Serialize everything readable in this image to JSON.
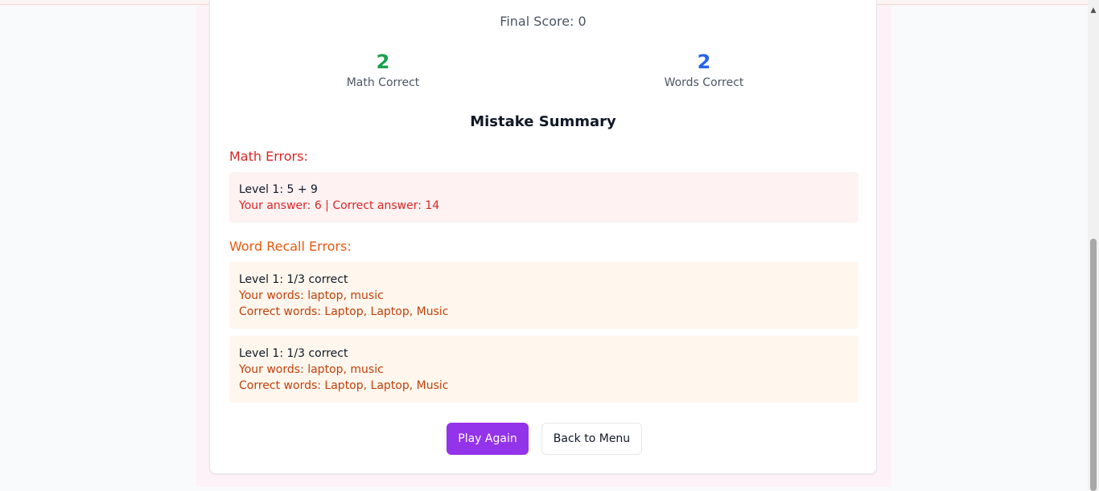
{
  "results": {
    "final_score": "Final Score: 0",
    "math_correct_value": "2",
    "math_correct_label": "Math Correct",
    "words_correct_value": "2",
    "words_correct_label": "Words Correct"
  },
  "summary": {
    "title": "Mistake Summary",
    "math_errors_title": "Math Errors:",
    "math_errors": [
      {
        "question": "Level 1: 5 + 9",
        "detail": "Your answer: 6 | Correct answer: 14"
      }
    ],
    "word_errors_title": "Word Recall Errors:",
    "word_errors": [
      {
        "heading": "Level 1: 1/3 correct",
        "your_words": "Your words: laptop, music",
        "correct_words": "Correct words: Laptop, Laptop, Music"
      },
      {
        "heading": "Level 1: 1/3 correct",
        "your_words": "Your words: laptop, music",
        "correct_words": "Correct words: Laptop, Laptop, Music"
      }
    ]
  },
  "actions": {
    "play_again": "Play Again",
    "back_to_menu": "Back to Menu"
  },
  "colors": {
    "green": "#16a34a",
    "blue": "#2563eb",
    "error_red": "#dc2626",
    "error_orange": "#ea580c",
    "primary_button": "#9333ea"
  },
  "scrollbar": {
    "up_icon": "scroll-up-arrow-icon"
  }
}
